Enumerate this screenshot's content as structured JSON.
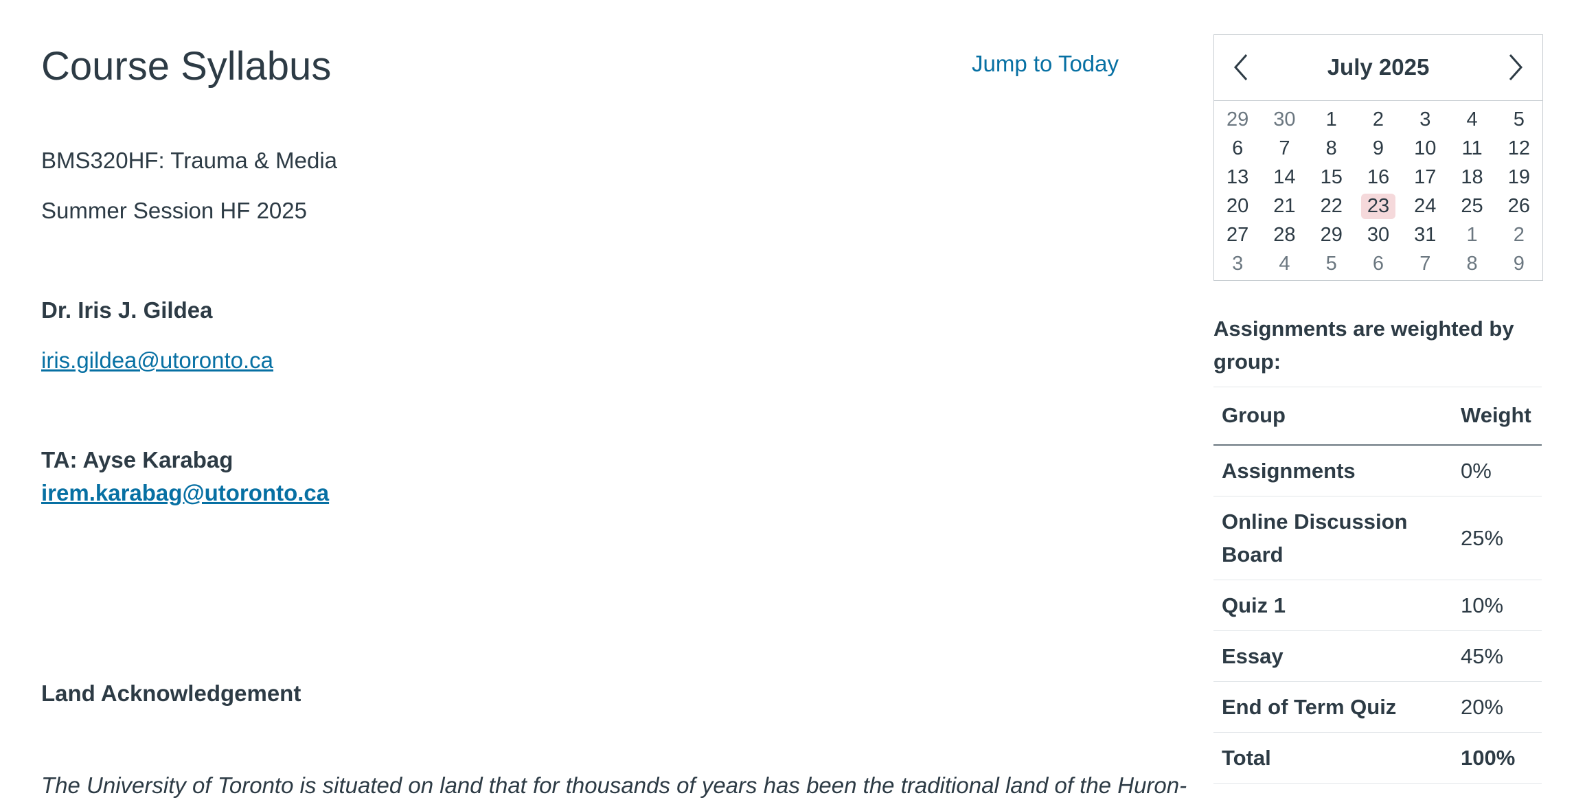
{
  "main": {
    "title": "Course Syllabus",
    "jump_today": "Jump to Today",
    "course_code": "BMS320HF: Trauma & Media",
    "session": "Summer Session HF 2025",
    "instructor_name": "Dr. Iris J. Gildea",
    "instructor_email": "iris.gildea@utoronto.ca",
    "ta_label": "TA: Ayse Karabag",
    "ta_email": "irem.karabag@utoronto.ca",
    "land_ack_heading": "Land Acknowledgement",
    "land_ack_text": "The University of Toronto is situated on land that for thousands of years has been the traditional land of the Huron-"
  },
  "calendar": {
    "month_label": "July 2025",
    "prev_icon": "chevron-left-icon",
    "next_icon": "chevron-right-icon",
    "today": 23,
    "weeks": [
      [
        {
          "d": "29",
          "o": true
        },
        {
          "d": "30",
          "o": true
        },
        {
          "d": "1"
        },
        {
          "d": "2"
        },
        {
          "d": "3"
        },
        {
          "d": "4"
        },
        {
          "d": "5"
        }
      ],
      [
        {
          "d": "6"
        },
        {
          "d": "7"
        },
        {
          "d": "8"
        },
        {
          "d": "9"
        },
        {
          "d": "10"
        },
        {
          "d": "11"
        },
        {
          "d": "12"
        }
      ],
      [
        {
          "d": "13"
        },
        {
          "d": "14"
        },
        {
          "d": "15"
        },
        {
          "d": "16"
        },
        {
          "d": "17"
        },
        {
          "d": "18"
        },
        {
          "d": "19"
        }
      ],
      [
        {
          "d": "20"
        },
        {
          "d": "21"
        },
        {
          "d": "22"
        },
        {
          "d": "23",
          "t": true
        },
        {
          "d": "24"
        },
        {
          "d": "25"
        },
        {
          "d": "26"
        }
      ],
      [
        {
          "d": "27"
        },
        {
          "d": "28"
        },
        {
          "d": "29"
        },
        {
          "d": "30"
        },
        {
          "d": "31"
        },
        {
          "d": "1",
          "o": true
        },
        {
          "d": "2",
          "o": true
        }
      ],
      [
        {
          "d": "3",
          "o": true
        },
        {
          "d": "4",
          "o": true
        },
        {
          "d": "5",
          "o": true
        },
        {
          "d": "6",
          "o": true
        },
        {
          "d": "7",
          "o": true
        },
        {
          "d": "8",
          "o": true
        },
        {
          "d": "9",
          "o": true
        }
      ]
    ],
    "colors": {
      "today_highlight": "#f5d9db",
      "other_month_text": "#6b7780"
    }
  },
  "weights": {
    "title": "Assignments are weighted by group:",
    "col_group": "Group",
    "col_weight": "Weight",
    "rows": [
      {
        "group": "Assignments",
        "weight": "0%"
      },
      {
        "group": "Online Discussion Board",
        "weight": "25%"
      },
      {
        "group": "Quiz 1",
        "weight": "10%"
      },
      {
        "group": "Essay",
        "weight": "45%"
      },
      {
        "group": "End of Term Quiz",
        "weight": "20%"
      }
    ],
    "total": {
      "group": "Total",
      "weight": "100%"
    }
  },
  "colors": {
    "link": "#0770a3",
    "text": "#2d3b45"
  }
}
